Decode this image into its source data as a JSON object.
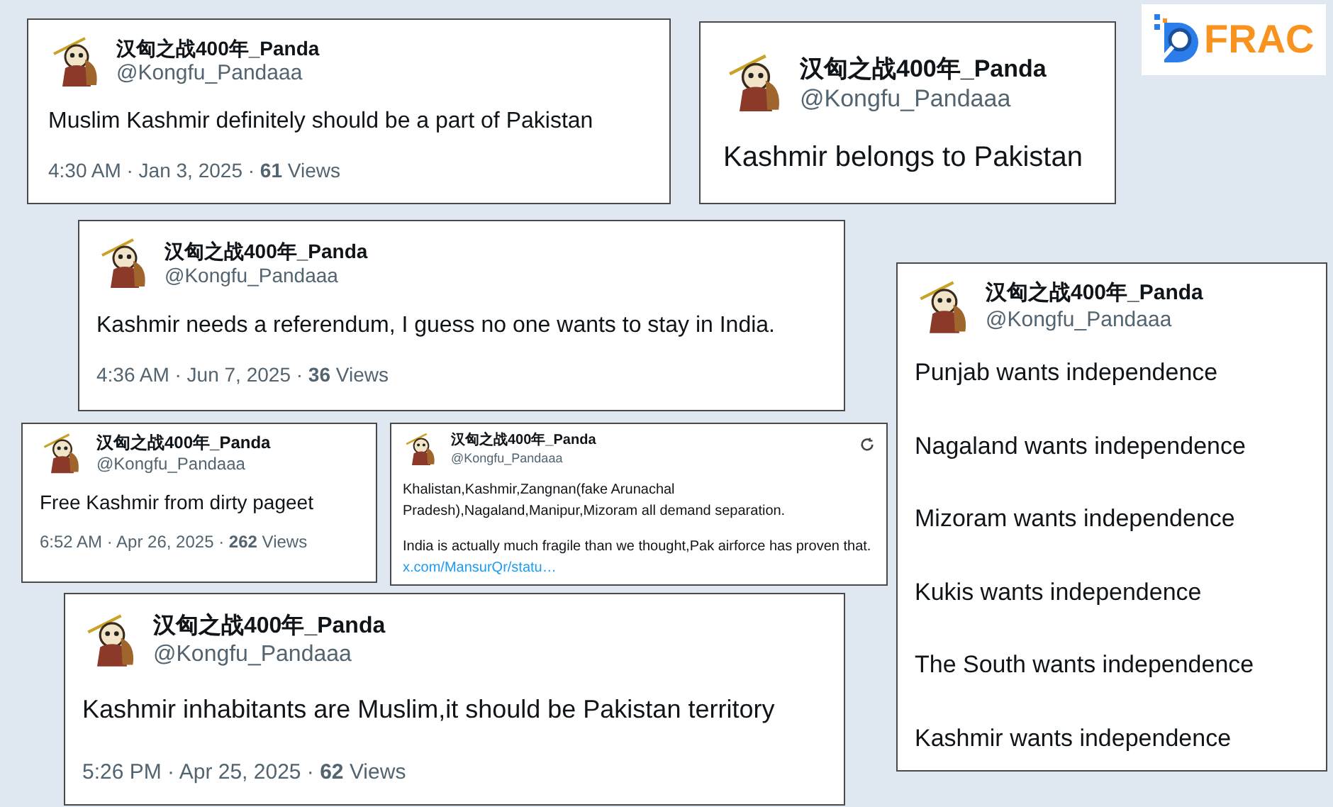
{
  "logo": {
    "text": "FRAC"
  },
  "cards": [
    {
      "name": "汉匈之战400年_Panda",
      "handle": "@Kongfu_Pandaaa",
      "paragraphs": [
        "Muslim Kashmir definitely should be a part of Pakistan"
      ],
      "footer": "4:30 AM · Jan 3, 2025 · **61** Views"
    },
    {
      "name": "汉匈之战400年_Panda",
      "handle": "@Kongfu_Pandaaa",
      "paragraphs": [
        "Kashmir belongs to Pakistan"
      ]
    },
    {
      "name": "汉匈之战400年_Panda",
      "handle": "@Kongfu_Pandaaa",
      "paragraphs": [
        "Kashmir needs a referendum, I guess no one wants to stay in India."
      ],
      "footer": "4:36 AM · Jun 7, 2025 · **36** Views"
    },
    {
      "name": "汉匈之战400年_Panda",
      "handle": "@Kongfu_Pandaaa",
      "paragraphs": [
        "Free Kashmir from dirty pageet"
      ],
      "footer": "6:52 AM · Apr 26, 2025 · **262** Views"
    },
    {
      "name": "汉匈之战400年_Panda",
      "handle": "@Kongfu_Pandaaa",
      "paragraphs": [
        "Khalistan,Kashmir,Zangnan(fake Arunachal Pradesh),Nagaland,Manipur,Mizoram all demand separation.",
        "India is actually much fragile than we thought,Pak airforce has proven that."
      ],
      "link": "x.com/MansurQr/statu…",
      "refresh_icon": true
    },
    {
      "name": "汉匈之战400年_Panda",
      "handle": "@Kongfu_Pandaaa",
      "paragraphs": [
        "Kashmir inhabitants are Muslim,it should be Pakistan territory"
      ],
      "footer": "5:26 PM · Apr 25, 2025 · **62** Views"
    },
    {
      "name": "汉匈之战400年_Panda",
      "handle": "@Kongfu_Pandaaa",
      "paragraphs": [
        "Punjab wants independence",
        "Nagaland wants independence",
        "Mizoram wants independence",
        "Kukis wants independence",
        "The South wants independence",
        "Kashmir wants independence"
      ]
    }
  ]
}
